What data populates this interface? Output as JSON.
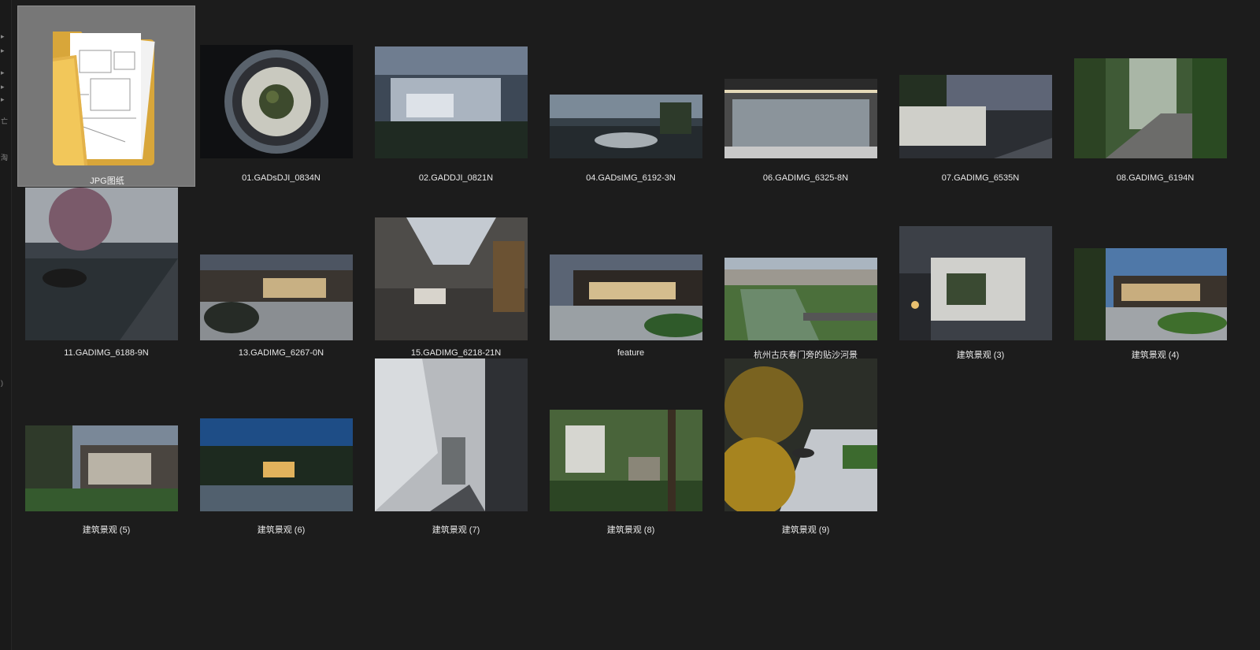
{
  "items": [
    {
      "name": "JPG图纸",
      "kind": "folder",
      "selected": true
    },
    {
      "name": "01.GADsDJI_0834N",
      "kind": "image"
    },
    {
      "name": "02.GADDJI_0821N",
      "kind": "image"
    },
    {
      "name": "04.GADsIMG_6192-3N",
      "kind": "image"
    },
    {
      "name": "06.GADIMG_6325-8N",
      "kind": "image"
    },
    {
      "name": "07.GADIMG_6535N",
      "kind": "image"
    },
    {
      "name": "08.GADIMG_6194N",
      "kind": "image"
    },
    {
      "name": "11.GADIMG_6188-9N",
      "kind": "image"
    },
    {
      "name": "13.GADIMG_6267-0N",
      "kind": "image"
    },
    {
      "name": "15.GADIMG_6218-21N",
      "kind": "image"
    },
    {
      "name": "feature",
      "kind": "image"
    },
    {
      "name": "杭州古庆春门旁的贴沙河景",
      "kind": "image"
    },
    {
      "name": "建筑景观 (3)",
      "kind": "image"
    },
    {
      "name": "建筑景观 (4)",
      "kind": "image"
    },
    {
      "name": "建筑景观 (5)",
      "kind": "image"
    },
    {
      "name": "建筑景观 (6)",
      "kind": "image"
    },
    {
      "name": "建筑景观 (7)",
      "kind": "image"
    },
    {
      "name": "建筑景观 (8)",
      "kind": "image"
    },
    {
      "name": "建筑景观 (9)",
      "kind": "image"
    }
  ],
  "left_strip_marks": [
    "▸",
    "▸",
    "▸",
    "▸",
    "▸",
    "亡",
    "淘",
    ")"
  ]
}
